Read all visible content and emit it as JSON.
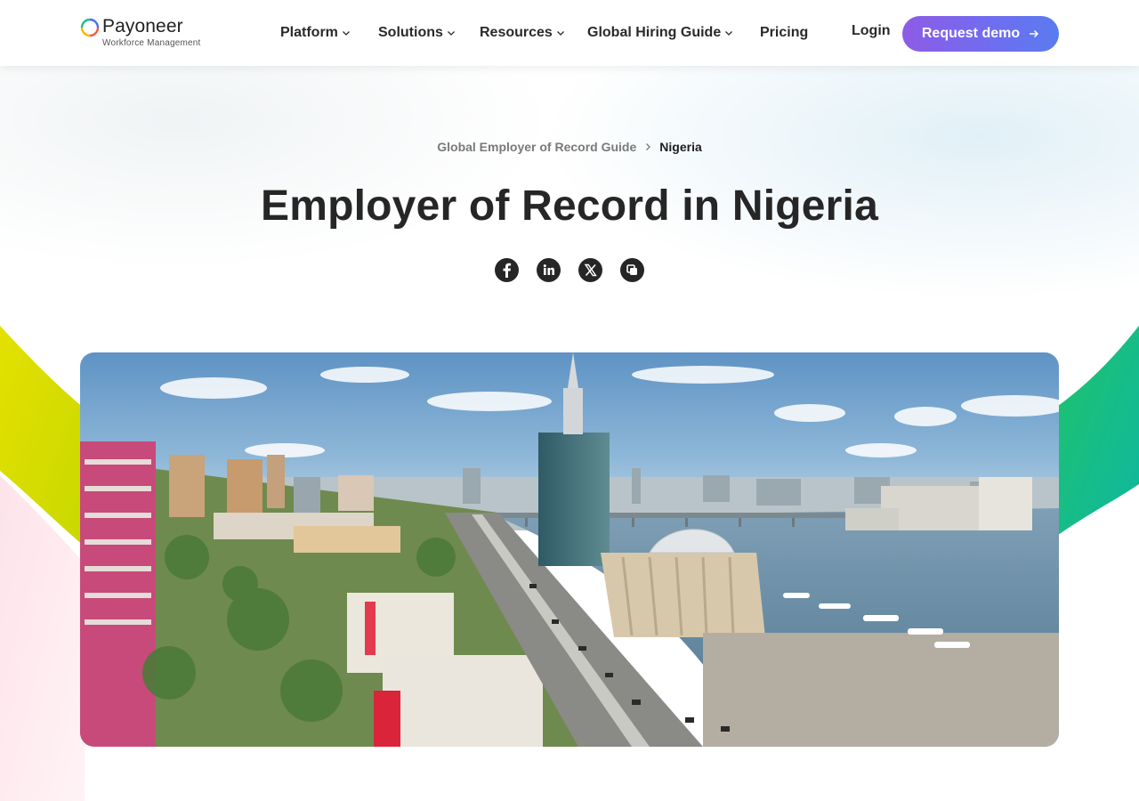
{
  "header": {
    "brand": "Payoneer",
    "brand_sub": "Workforce Management",
    "nav": [
      {
        "label": "Platform",
        "has_menu": true
      },
      {
        "label": "Solutions",
        "has_menu": true
      },
      {
        "label": "Resources",
        "has_menu": true
      },
      {
        "label": "Global Hiring Guide",
        "has_menu": true
      },
      {
        "label": "Pricing",
        "has_menu": false
      }
    ],
    "login_label": "Login",
    "demo_label": "Request demo"
  },
  "breadcrumb": {
    "parent": "Global Employer of Record Guide",
    "current": "Nigeria"
  },
  "hero": {
    "title": "Employer of Record in Nigeria"
  },
  "share": [
    {
      "icon": "facebook-icon"
    },
    {
      "icon": "linkedin-icon"
    },
    {
      "icon": "x-twitter-icon"
    },
    {
      "icon": "copy-link-icon"
    }
  ],
  "colors": {
    "accent_start": "#8e5be6",
    "accent_end": "#5a7bf0",
    "text": "#262626",
    "swoosh_left": "#d7dc00",
    "swoosh_right": "#14c08a"
  }
}
